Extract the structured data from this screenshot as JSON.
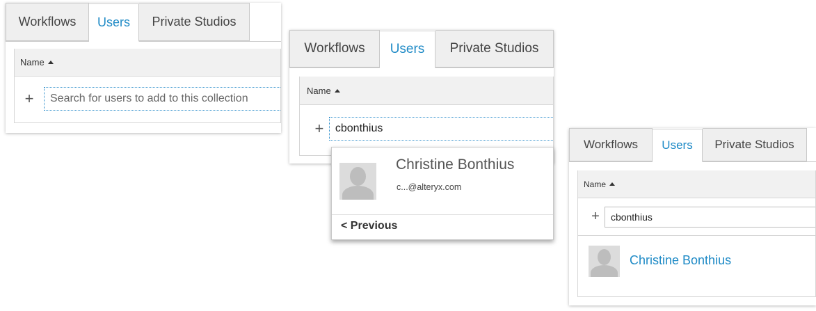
{
  "tabs": [
    "Workflows",
    "Users",
    "Private Studios"
  ],
  "table": {
    "name_header": "Name"
  },
  "search": {
    "placeholder": "Search for users to add to this collection",
    "typed_value": "cbonthius"
  },
  "suggestion": {
    "name": "Christine Bonthius",
    "email": "c...@alteryx.com",
    "previous_label": "< Previous"
  },
  "added_user": {
    "name": "Christine Bonthius"
  },
  "colors": {
    "accent": "#1e8ac6",
    "tab_inactive_bg": "#efefef",
    "header_bg": "#f1f1f1"
  }
}
